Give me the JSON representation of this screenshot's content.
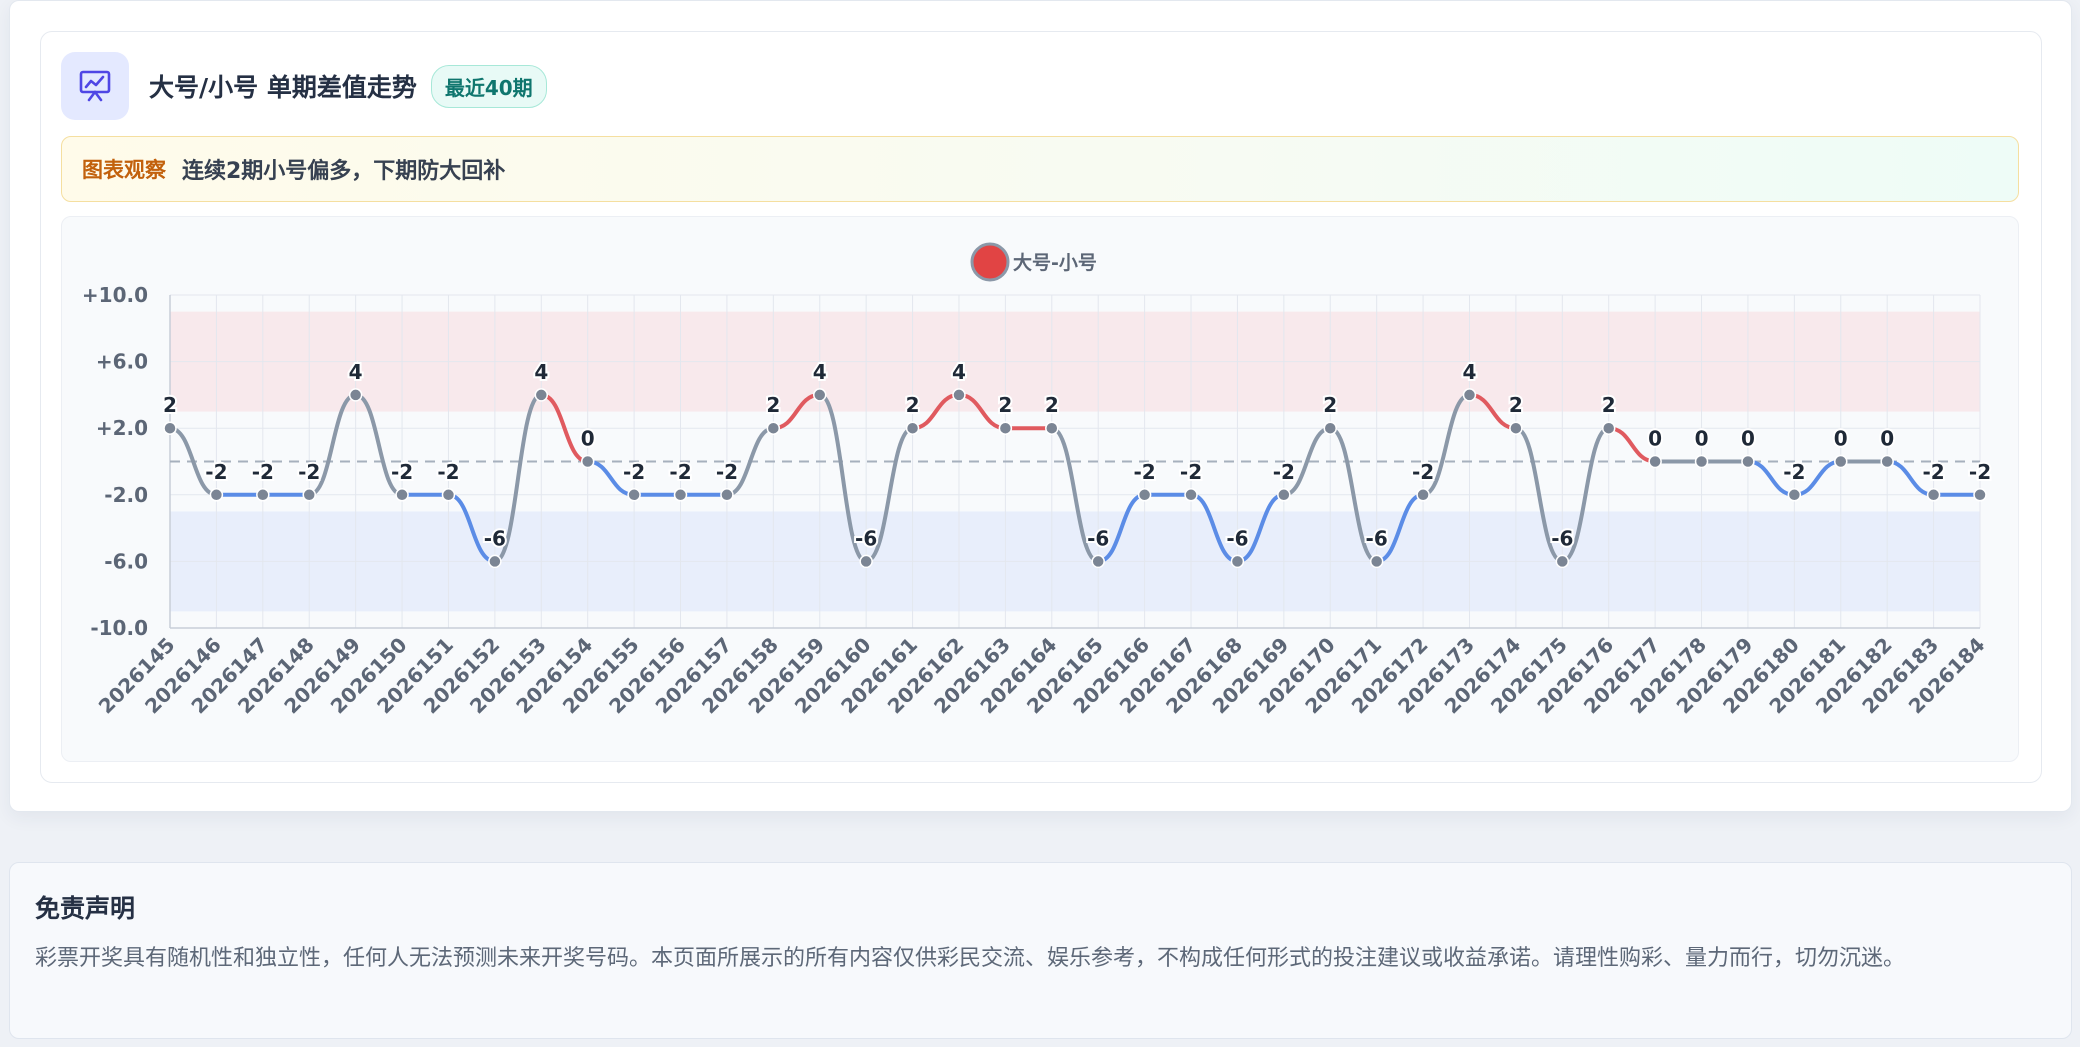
{
  "header": {
    "title": "大号/小号 单期差值走势",
    "badge": "最近40期",
    "icon": "trend-chart-icon"
  },
  "observation": {
    "label": "图表观察",
    "text": "连续2期小号偏多，下期防大回补"
  },
  "chart_data": {
    "type": "line",
    "title": "",
    "legend": {
      "label": "大号-小号",
      "placement": "top-center"
    },
    "xlabel": "",
    "ylabel": "",
    "ylim": [
      -10,
      10
    ],
    "yticks": [
      "+10.0",
      "+6.0",
      "+2.0",
      "-2.0",
      "-6.0",
      "-10.0"
    ],
    "reference_line": 0,
    "bands": [
      {
        "from": 3,
        "to": 9,
        "color": "#f8e9ec"
      },
      {
        "from": -9,
        "to": -3,
        "color": "#e8eefb"
      }
    ],
    "grid": true,
    "colors": {
      "positive": "#e05a5f",
      "negative": "#5b8ce6",
      "neutral": "#8b98a8",
      "legend_marker": "#e14444"
    },
    "categories": [
      "2026145",
      "2026146",
      "2026147",
      "2026148",
      "2026149",
      "2026150",
      "2026151",
      "2026152",
      "2026153",
      "2026154",
      "2026155",
      "2026156",
      "2026157",
      "2026158",
      "2026159",
      "2026160",
      "2026161",
      "2026162",
      "2026163",
      "2026164",
      "2026165",
      "2026166",
      "2026167",
      "2026168",
      "2026169",
      "2026170",
      "2026171",
      "2026172",
      "2026173",
      "2026174",
      "2026175",
      "2026176",
      "2026177",
      "2026178",
      "2026179",
      "2026180",
      "2026181",
      "2026182",
      "2026183",
      "2026184"
    ],
    "series": [
      {
        "name": "大号-小号",
        "values": [
          2,
          -2,
          -2,
          -2,
          4,
          -2,
          -2,
          -6,
          4,
          0,
          -2,
          -2,
          -2,
          2,
          4,
          -6,
          2,
          4,
          2,
          2,
          -6,
          -2,
          -2,
          -6,
          -2,
          2,
          -6,
          -2,
          4,
          2,
          -6,
          2,
          0,
          0,
          0,
          -2,
          0,
          0,
          -2,
          -2
        ]
      }
    ]
  },
  "disclaimer": {
    "title": "免责声明",
    "text": "彩票开奖具有随机性和独立性，任何人无法预测未来开奖号码。本页面所展示的所有内容仅供彩民交流、娱乐参考，不构成任何形式的投注建议或收益承诺。请理性购彩、量力而行，切勿沉迷。"
  }
}
